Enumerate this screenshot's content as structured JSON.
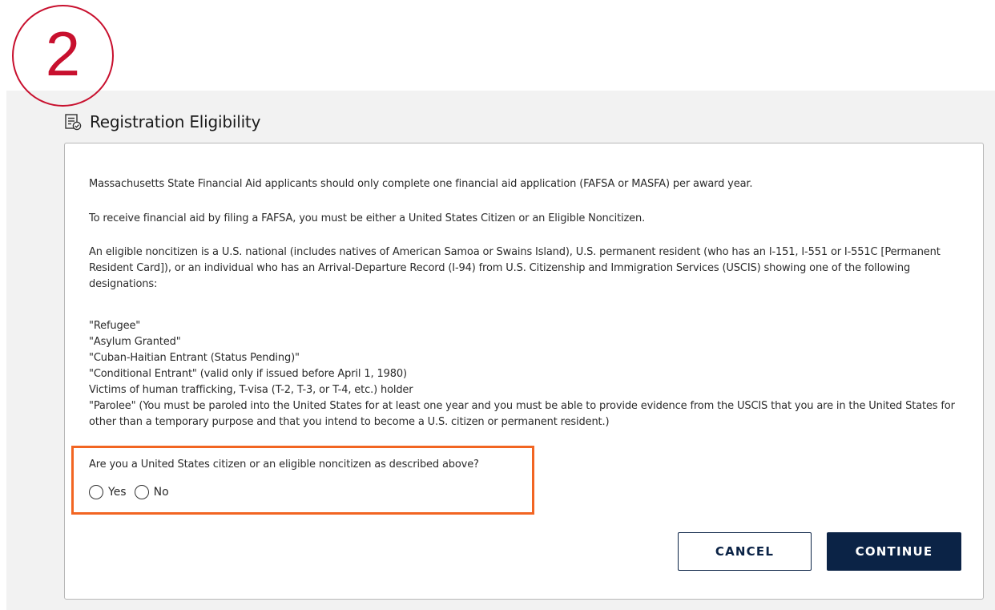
{
  "step": {
    "number": "2",
    "color": "#c8102e"
  },
  "section": {
    "title": "Registration Eligibility",
    "icon": "document-check-icon"
  },
  "content": {
    "paragraph1": "Massachusetts State Financial Aid applicants should only complete one financial aid application (FAFSA or MASFA) per award year.",
    "paragraph2": "To receive financial aid by filing a FAFSA, you must be either a United States Citizen or an Eligible Noncitizen.",
    "paragraph3": "An eligible noncitizen is a U.S. national (includes natives of American Samoa or Swains Island), U.S. permanent resident (who has an I-151, I-551 or I-551C [Permanent Resident Card]), or an individual who has an Arrival-Departure Record (I-94) from U.S. Citizenship and Immigration Services (USCIS) showing one of the following designations:",
    "designations": [
      "\"Refugee\"",
      "\"Asylum Granted\"",
      "\"Cuban-Haitian Entrant (Status Pending)\"",
      "\"Conditional Entrant\" (valid only if issued before April 1, 1980)",
      "Victims of human trafficking, T-visa (T-2, T-3, or T-4, etc.) holder",
      "\"Parolee\" (You must be paroled into the United States for at least one year and you must be able to provide evidence from the USCIS that you are in the United States for other than a temporary purpose and that you intend to become a U.S. citizen or permanent resident.)"
    ]
  },
  "question": {
    "text": "Are you a United States citizen or an eligible noncitizen as described above?",
    "options": [
      {
        "label": "Yes",
        "selected": false
      },
      {
        "label": "No",
        "selected": false
      }
    ],
    "highlight_color": "#f26522"
  },
  "buttons": {
    "cancel": "CANCEL",
    "continue": "CONTINUE",
    "primary_color": "#0b2346"
  }
}
